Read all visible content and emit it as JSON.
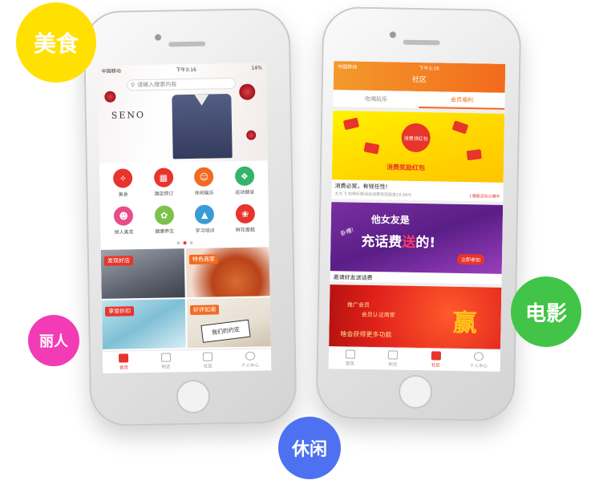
{
  "bubbles": {
    "food": "美食",
    "beauty": "丽人",
    "movie": "电影",
    "leisure": "休闲"
  },
  "phone1": {
    "status": {
      "carrier": "中国移动",
      "time": "下午3:16",
      "battery": "14%"
    },
    "search_placeholder": "请输入搜索内容",
    "banner_brand": "SENO",
    "categories": [
      {
        "label": "美食",
        "color": "#e8352c",
        "icon": "fork-knife-icon"
      },
      {
        "label": "酒店预订",
        "color": "#e8352c",
        "icon": "bed-icon"
      },
      {
        "label": "休闲娱乐",
        "color": "#f26a21",
        "icon": "smile-icon"
      },
      {
        "label": "运动健身",
        "color": "#34b36b",
        "icon": "dumbbell-icon"
      },
      {
        "label": "丽人美发",
        "color": "#e84c8b",
        "icon": "face-icon"
      },
      {
        "label": "健康养生",
        "color": "#7cc24a",
        "icon": "leaf-icon"
      },
      {
        "label": "学习培训",
        "color": "#3a9bd8",
        "icon": "cap-icon"
      },
      {
        "label": "鲜花蛋糕",
        "color": "#e8352c",
        "icon": "flower-icon"
      }
    ],
    "tiles": [
      {
        "label": "发现好店",
        "tag_color": "#e8352c"
      },
      {
        "label": "特色商家",
        "tag_color": "#f26a21"
      },
      {
        "label": "享受折扣",
        "tag_color": "#e8352c"
      },
      {
        "label": "好评如潮",
        "tag_color": "#f26a21"
      }
    ],
    "tile4_card": "我们的约定",
    "tabs": [
      {
        "label": "首页",
        "active": true
      },
      {
        "label": "附近",
        "active": false
      },
      {
        "label": "社区",
        "active": false
      },
      {
        "label": "个人中心",
        "active": false
      }
    ]
  },
  "phone2": {
    "status": {
      "carrier": "中国移动",
      "time": "下午3:16",
      "battery": ""
    },
    "title": "社区",
    "segments": [
      {
        "label": "吃喝玩乐",
        "active": false
      },
      {
        "label": "会员福利",
        "active": true
      }
    ],
    "cards": [
      {
        "title": "消费必奖，有钱任性!",
        "sub": "大大飞 吃喝乐购活动消费有奖励金18.88元",
        "tag": "1通报活动火爆中",
        "badge": "消费领红包",
        "caption": "消费奖励红包"
      },
      {
        "title": "邀请好友送话费",
        "sub": "",
        "tag": "",
        "head": "他女友是",
        "main_a": "充话费",
        "main_b": "送",
        "main_c": "的!",
        "side": "卧槽!",
        "button": "立即参加"
      },
      {
        "title": "",
        "line1": "推广会员",
        "line2": "会员认证商家",
        "line3": "啥会获得更多功能",
        "big": "赢"
      }
    ],
    "tabs": [
      {
        "label": "首页",
        "active": false
      },
      {
        "label": "附近",
        "active": false
      },
      {
        "label": "社区",
        "active": true
      },
      {
        "label": "个人中心",
        "active": false
      }
    ]
  }
}
